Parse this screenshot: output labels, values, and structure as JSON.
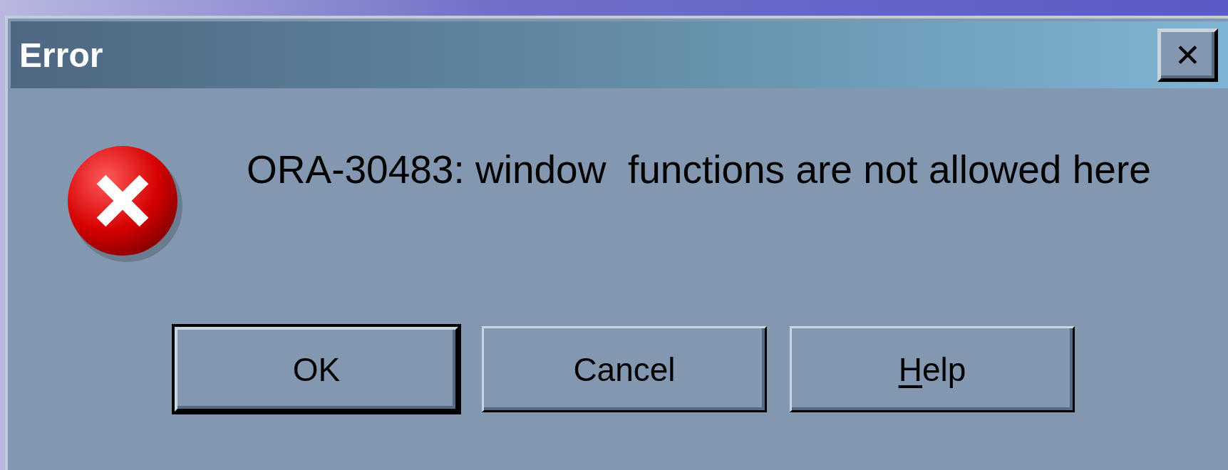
{
  "window": {
    "title": "Error",
    "close_button": "✕"
  },
  "dialog": {
    "message": "ORA-30483: window  functions are not allowed here"
  },
  "buttons": [
    {
      "label": "OK",
      "default": true,
      "mnemonic": false
    },
    {
      "label": "Cancel",
      "default": false,
      "mnemonic": false
    },
    {
      "label": "Help",
      "default": false,
      "mnemonic": true
    }
  ]
}
